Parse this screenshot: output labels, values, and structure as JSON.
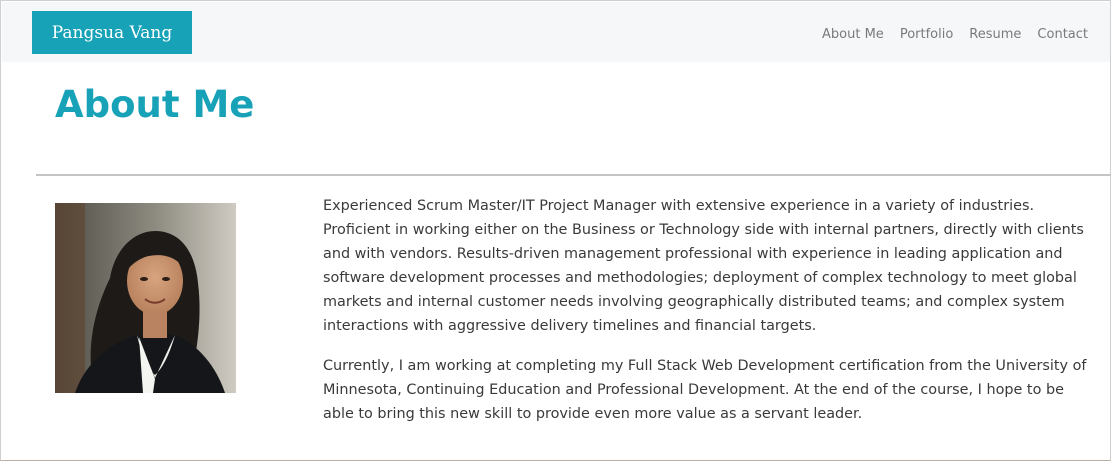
{
  "brand": {
    "name": "Pangsua Vang"
  },
  "nav": {
    "items": [
      {
        "label": "About Me"
      },
      {
        "label": "Portfolio"
      },
      {
        "label": "Resume"
      },
      {
        "label": "Contact"
      }
    ]
  },
  "main": {
    "title": "About Me",
    "photo_icon": "profile-photo",
    "paragraphs": [
      "Experienced Scrum Master/IT Project Manager with extensive experience in a variety of industries. Proficient in working either on the Business or Technology side with internal partners, directly with clients and with vendors. Results-driven management professional with experience in leading application and software development processes and methodologies; deployment of complex technology to meet global markets and internal customer needs involving geographically distributed teams; and complex system interactions with aggressive delivery timelines and financial targets.",
      "Currently, I am working at completing my Full Stack Web Development certification from the University of Minnesota, Continuing Education and Professional Development. At the end of the course, I hope to be able to bring this new skill to provide even more value as a servant leader."
    ]
  },
  "colors": {
    "accent": "#17a2b8",
    "nav_background": "#f6f7f9",
    "nav_text": "#7a7a7a",
    "body_text": "#3a3a3a"
  }
}
